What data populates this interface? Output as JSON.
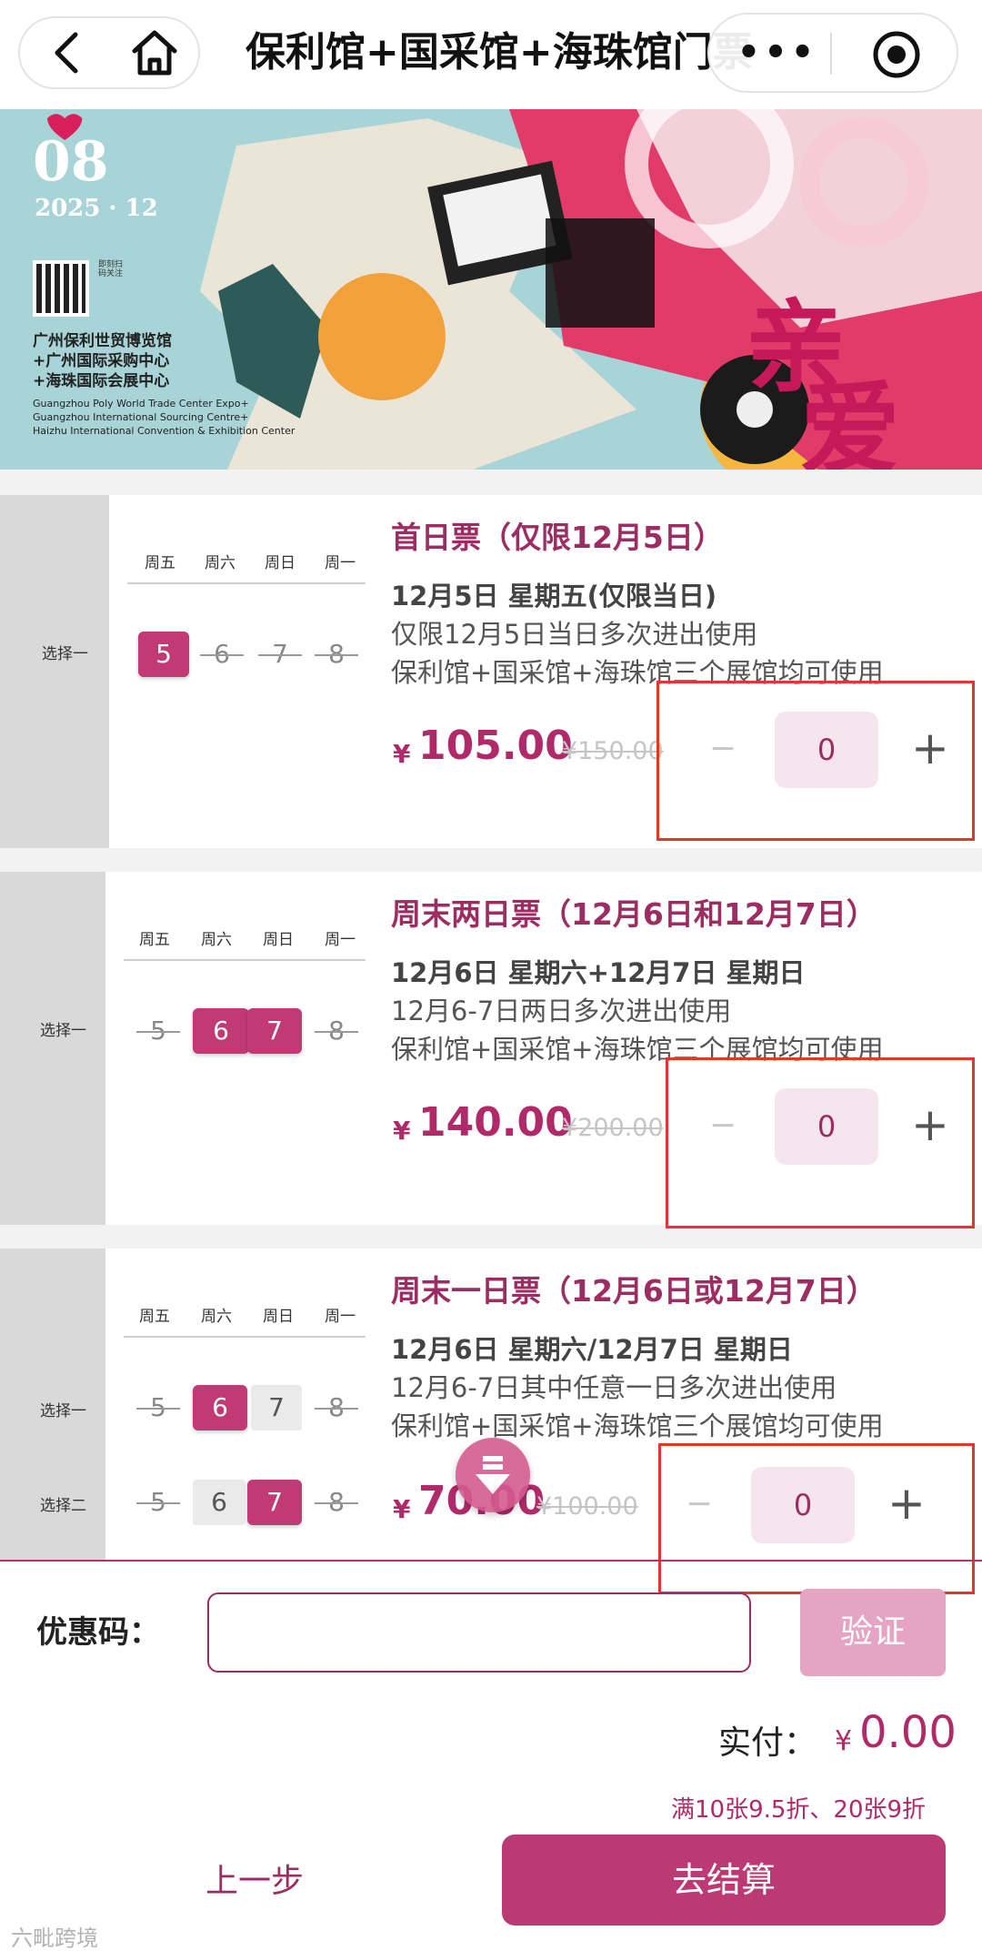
{
  "nav": {
    "title": "保利馆+国采馆+海珠馆门票",
    "more": "•••"
  },
  "banner": {
    "date_day": "08",
    "date_year": "2025 · 12",
    "qr_note": "即刻扫码关注",
    "venue_cn_1": "广州保利世贸博览馆",
    "venue_cn_2": "+广州国际采购中心",
    "venue_cn_3": "+海珠国际会展中心",
    "venue_en_1": "Guangzhou Poly World Trade Center Expo+",
    "venue_en_2": "Guangzhou International Sourcing Centre+",
    "venue_en_3": "Haizhu International Convention & Exhibition Center"
  },
  "weekdays": [
    "周五",
    "周六",
    "周日",
    "周一"
  ],
  "tickets": [
    {
      "option_labels": [
        "选择一"
      ],
      "day_rows": [
        [
          {
            "num": "5",
            "state": "active"
          },
          {
            "num": "6",
            "state": "strike"
          },
          {
            "num": "7",
            "state": "strike"
          },
          {
            "num": "8",
            "state": "strike"
          }
        ]
      ],
      "title": "首日票（仅限12月5日）",
      "date": "12月5日 星期五(仅限当日)",
      "desc_1": "仅限12月5日当日多次进出使用",
      "desc_2": "保利馆+国采馆+海珠馆三个展馆均可使用",
      "currency": "¥",
      "price": "105.00",
      "old_price": "¥150.00",
      "quantity": "0",
      "minus": "−",
      "plus": "+"
    },
    {
      "option_labels": [
        "选择一"
      ],
      "day_rows": [
        [
          {
            "num": "5",
            "state": "strike"
          },
          {
            "num": "6",
            "state": "active"
          },
          {
            "num": "7",
            "state": "active"
          },
          {
            "num": "8",
            "state": "strike"
          }
        ]
      ],
      "title": "周末两日票（12月6日和12月7日）",
      "date": "12月6日 星期六+12月7日 星期日",
      "desc_1": "12月6-7日两日多次进出使用",
      "desc_2": "保利馆+国采馆+海珠馆三个展馆均可使用",
      "currency": "¥",
      "price": "140.00",
      "old_price": "¥200.00",
      "quantity": "0",
      "minus": "−",
      "plus": "+"
    },
    {
      "option_labels": [
        "选择一",
        "选择二"
      ],
      "day_rows": [
        [
          {
            "num": "5",
            "state": "strike"
          },
          {
            "num": "6",
            "state": "active"
          },
          {
            "num": "7",
            "state": "plain"
          },
          {
            "num": "8",
            "state": "strike"
          }
        ],
        [
          {
            "num": "5",
            "state": "strike"
          },
          {
            "num": "6",
            "state": "plain"
          },
          {
            "num": "7",
            "state": "active"
          },
          {
            "num": "8",
            "state": "strike"
          }
        ]
      ],
      "title": "周末一日票（12月6日或12月7日）",
      "date": "12月6日 星期六/12月7日 星期日",
      "desc_1": "12月6-7日其中任意一日多次进出使用",
      "desc_2": "保利馆+国采馆+海珠馆三个展馆均可使用",
      "currency": "¥",
      "price": "70.00",
      "old_price": "¥100.00",
      "quantity": "0",
      "minus": "−",
      "plus": "+"
    }
  ],
  "checkout": {
    "coupon_label": "优惠码：",
    "coupon_value": "",
    "verify_label": "验证",
    "pay_label": "实付：",
    "currency": "¥",
    "pay_amount": "0.00",
    "discount_note": "满10张9.5折、20张9折",
    "prev_label": "上一步",
    "checkout_label": "去结算"
  },
  "watermark": "六毗跨境",
  "colors": {
    "accent": "#b02a6a",
    "accent_dark": "#9c2d62",
    "button": "#bb3a73",
    "verify_disabled": "#e5a4c3",
    "highlight_frame": "#e8332e"
  }
}
